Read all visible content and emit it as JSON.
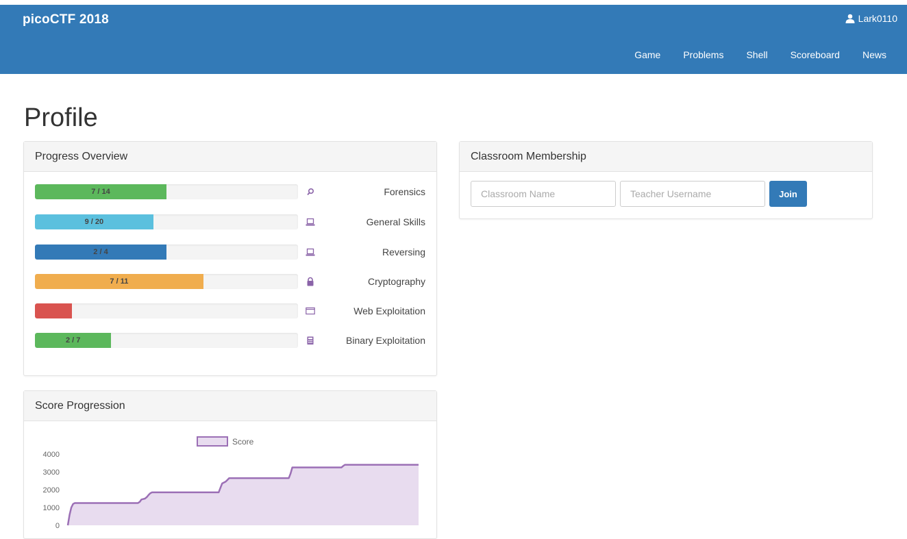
{
  "navbar": {
    "brand": "picoCTF 2018",
    "user": "Lark0110",
    "links": [
      "Game",
      "Problems",
      "Shell",
      "Scoreboard",
      "News"
    ],
    "color": "#337ab7"
  },
  "page_title": "Profile",
  "progress": {
    "title": "Progress Overview",
    "items": [
      {
        "label": "Forensics",
        "text": "7 / 14",
        "fraction": 0.5,
        "color": "#5cb85c",
        "icon": "search-icon"
      },
      {
        "label": "General Skills",
        "text": "9 / 20",
        "fraction": 0.45,
        "color": "#5bc0de",
        "icon": "laptop-icon"
      },
      {
        "label": "Reversing",
        "text": "2 / 4",
        "fraction": 0.5,
        "color": "#337ab7",
        "icon": "laptop-icon"
      },
      {
        "label": "Cryptography",
        "text": "7 / 11",
        "fraction": 0.64,
        "color": "#f0ad4e",
        "icon": "lock-icon"
      },
      {
        "label": "Web Exploitation",
        "text": "",
        "fraction": 0.14,
        "color": "#d9534f",
        "icon": "browser-window-icon"
      },
      {
        "label": "Binary Exploitation",
        "text": "2 / 7",
        "fraction": 0.29,
        "color": "#5cb85c",
        "icon": "calculator-icon"
      }
    ]
  },
  "classroom": {
    "title": "Classroom Membership",
    "name_placeholder": "Classroom Name",
    "teacher_placeholder": "Teacher Username",
    "join_label": "Join"
  },
  "score": {
    "title": "Score Progression"
  },
  "chart_data": {
    "type": "area",
    "series": [
      {
        "name": "Score",
        "color": "#9b6fb5",
        "fill": "#e8dcef"
      }
    ],
    "yticks": [
      0,
      1000,
      2000,
      3000,
      4000
    ],
    "ylim": [
      0,
      4000
    ],
    "xlim": [
      0,
      100
    ],
    "x": [
      0,
      0.5,
      1,
      1.5,
      2,
      20,
      20.5,
      21,
      22,
      22.5,
      23,
      23.5,
      24,
      43,
      43.5,
      44,
      45,
      45.5,
      46,
      63,
      63.5,
      64,
      78,
      78.5,
      79,
      100
    ],
    "y": [
      0,
      600,
      1000,
      1200,
      1250,
      1250,
      1320,
      1450,
      1500,
      1580,
      1700,
      1800,
      1850,
      1850,
      2100,
      2350,
      2450,
      2550,
      2650,
      2650,
      2900,
      3250,
      3250,
      3330,
      3400,
      3400
    ],
    "grid": false,
    "legend": "top-center"
  }
}
